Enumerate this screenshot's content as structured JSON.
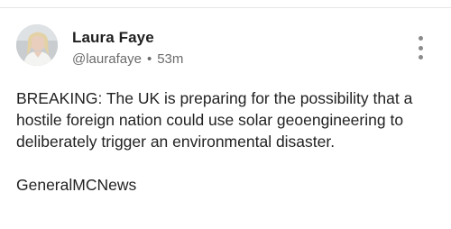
{
  "post": {
    "author": {
      "display_name": "Laura Faye",
      "handle": "@laurafaye",
      "timestamp": "53m",
      "separator": "•"
    },
    "body": "BREAKING: The UK is preparing for the possibility that a hostile foreign nation could use solar geoengineering to deliberately trigger an environmental disaster.\n\nGeneralMCNews",
    "menu_icon": "more-vertical-icon"
  },
  "colors": {
    "text_primary": "#1f1f1f",
    "text_secondary": "#6b6b6b",
    "divider": "#e6e6e6",
    "icon": "#8a8a8a"
  }
}
